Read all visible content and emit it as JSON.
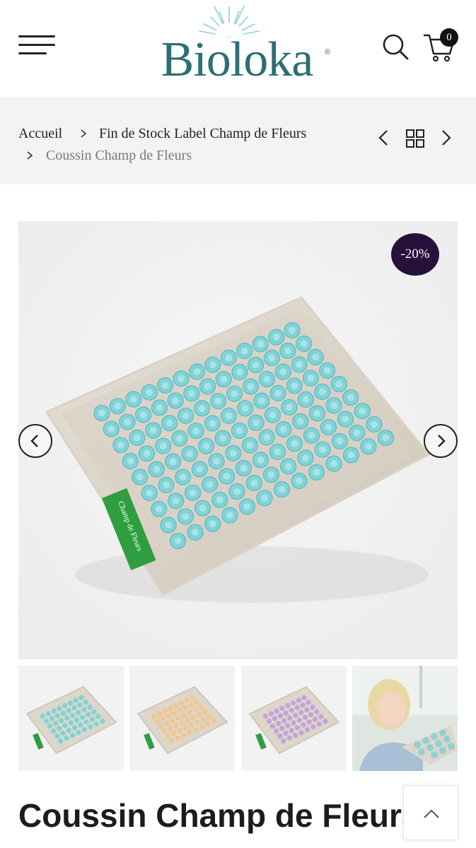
{
  "header": {
    "brand": "Bioloka",
    "registered_mark": "®",
    "cart_count": "0",
    "icons": [
      "hamburger-menu-icon",
      "search-icon",
      "cart-icon"
    ]
  },
  "breadcrumb": {
    "items": [
      {
        "label": "Accueil"
      },
      {
        "label": "Fin de Stock Label Champ de Fleurs"
      },
      {
        "label": "Coussin Champ de Fleurs"
      }
    ],
    "icons": [
      "chevron-left-icon",
      "grid-icon",
      "chevron-right-icon"
    ]
  },
  "gallery": {
    "discount_badge": "-20%",
    "tag_text": "Champ de Fleurs",
    "thumbnails": [
      {
        "variant": "turquoise",
        "color": "#7fd3d6"
      },
      {
        "variant": "orange",
        "color": "#f2c68c"
      },
      {
        "variant": "violet",
        "color": "#c3a3dd"
      },
      {
        "variant": "lifestyle",
        "color": "#8fd2d3"
      }
    ]
  },
  "product": {
    "title": "Coussin Champ de Fleurs"
  },
  "colors": {
    "brand": "#2c6f74",
    "badge": "#27103a",
    "spikes": "#7fd3d6",
    "tag": "#2e9e3f"
  }
}
